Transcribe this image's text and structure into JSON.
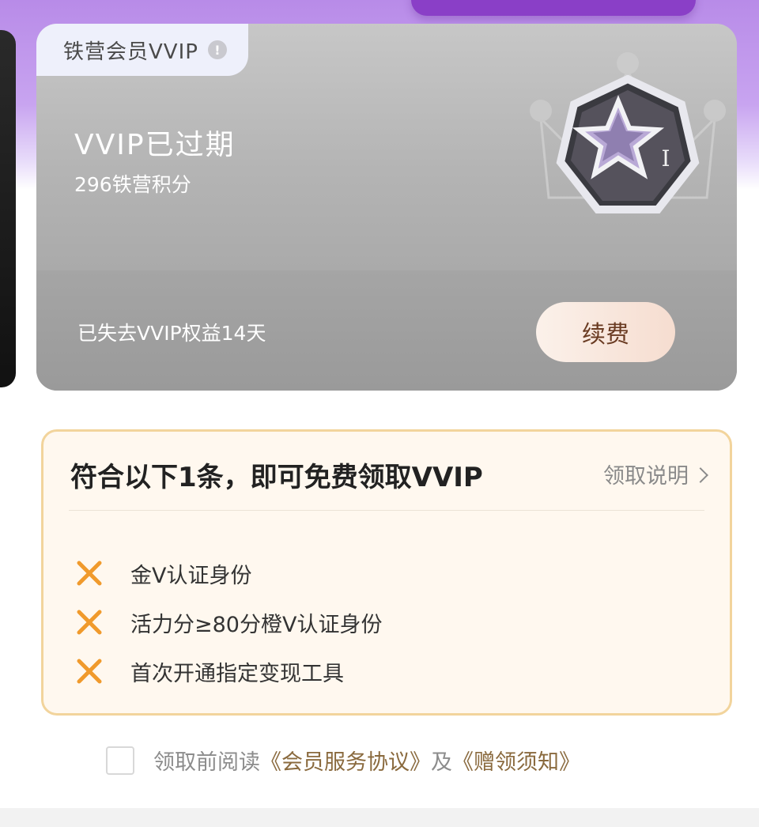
{
  "vip_card": {
    "tag_label": "铁营会员VVIP",
    "status": "VVIP已过期",
    "points": "296铁营积分",
    "lost_benefits": "已失去VVIP权益14天",
    "renew_label": "续费",
    "badge_level": "I"
  },
  "conditions": {
    "title": "符合以下1条，即可免费领取VVIP",
    "link_label": "领取说明",
    "items": [
      {
        "text": "金V认证身份",
        "met": false
      },
      {
        "text": "活力分≥80分橙V认证身份",
        "met": false
      },
      {
        "text": "首次开通指定变现工具",
        "met": false
      }
    ]
  },
  "agreement": {
    "prefix": "领取前阅读",
    "service_agreement": "《会员服务协议》",
    "conjunction": "及",
    "gift_notice": "《赠领须知》"
  },
  "colors": {
    "x_mark": "#f09a2c",
    "card_border": "#f2d49c",
    "purple_band": "#b88be8"
  }
}
